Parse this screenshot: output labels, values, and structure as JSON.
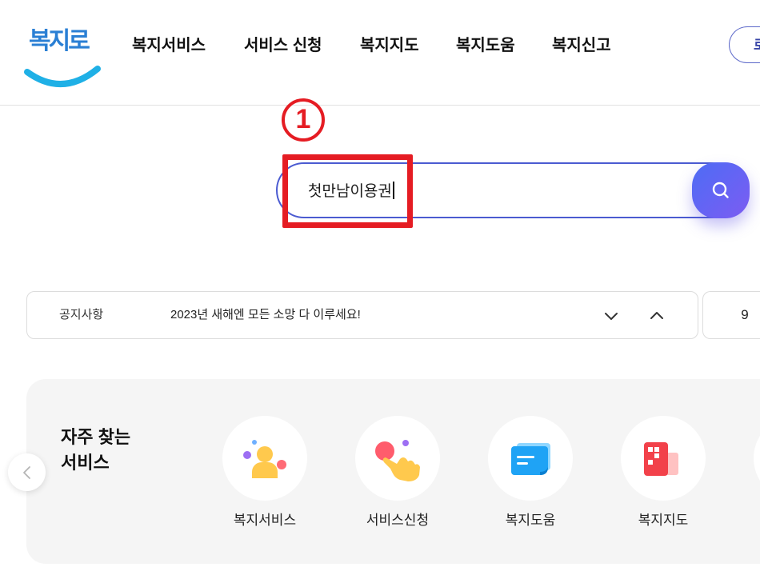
{
  "header": {
    "logo_text": "복지로",
    "nav": [
      {
        "label": "복지서비스"
      },
      {
        "label": "서비스 신청"
      },
      {
        "label": "복지지도"
      },
      {
        "label": "복지도움"
      },
      {
        "label": "복지신고"
      }
    ],
    "right_button_label": "로"
  },
  "annotation": {
    "step_number": "1"
  },
  "search": {
    "value": "첫만남이용권",
    "button_icon": "search-icon"
  },
  "notice": {
    "label": "공지사항",
    "message": "2023년 새해엔 모든 소망 다 이루세요!",
    "down_icon": "chevron-down-icon",
    "up_icon": "chevron-up-icon",
    "counter": "9"
  },
  "frequent_services": {
    "title_line1": "자주 찾는",
    "title_line2": "서비스",
    "prev_icon": "chevron-left-icon",
    "items": [
      {
        "label": "복지서비스",
        "icon": "person-icon"
      },
      {
        "label": "서비스신청",
        "icon": "hand-pointer-icon"
      },
      {
        "label": "복지도움",
        "icon": "chat-bubble-icon"
      },
      {
        "label": "복지지도",
        "icon": "map-grid-icon"
      }
    ]
  },
  "colors": {
    "brand_blue": "#2a7fd4",
    "logo_smile": "#1fb0e6",
    "search_border": "#4b5bd1",
    "search_button_from": "#4d6cf5",
    "search_button_to": "#7c5cf2",
    "annotation_red": "#e51c23",
    "section_bg": "#f5f5f5"
  }
}
